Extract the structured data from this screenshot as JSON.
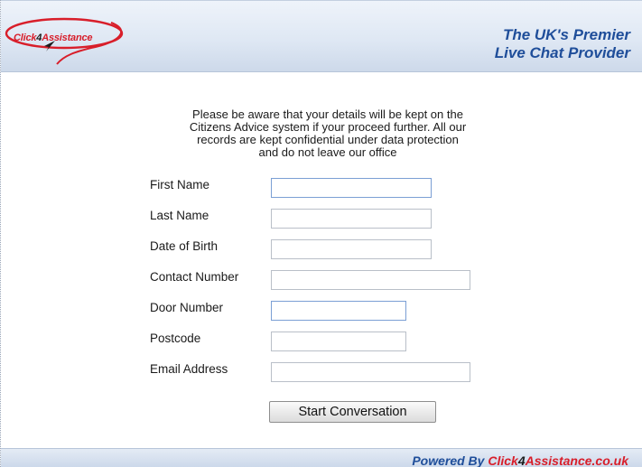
{
  "header": {
    "logo": {
      "brand_prefix": "Click",
      "brand_number": "4",
      "brand_suffix": "Assistance",
      "icon": "cursor-arrow-icon",
      "swoosh_color": "#d81e2a"
    },
    "tagline_line1": "The UK's Premier",
    "tagline_line2": "Live Chat Provider",
    "tagline_color": "#1f4e9a"
  },
  "notice": {
    "line1": "Please be aware that your details will be kept on the",
    "line2": "Citizens Advice system if your proceed further. All our",
    "line3": "records are kept confidential under data protection",
    "line4": "and do not leave our office"
  },
  "form": {
    "fields": [
      {
        "label": "First Name",
        "value": ""
      },
      {
        "label": "Last Name",
        "value": ""
      },
      {
        "label": "Date of Birth",
        "value": ""
      },
      {
        "label": "Contact Number",
        "value": ""
      },
      {
        "label": "Door Number",
        "value": ""
      },
      {
        "label": "Postcode",
        "value": ""
      },
      {
        "label": "Email Address",
        "value": ""
      }
    ],
    "submit_label": "Start Conversation"
  },
  "footer": {
    "prefix": "Powered By ",
    "brand_prefix": "Click",
    "brand_number": "4",
    "brand_suffix": "Assistance.co.uk"
  }
}
